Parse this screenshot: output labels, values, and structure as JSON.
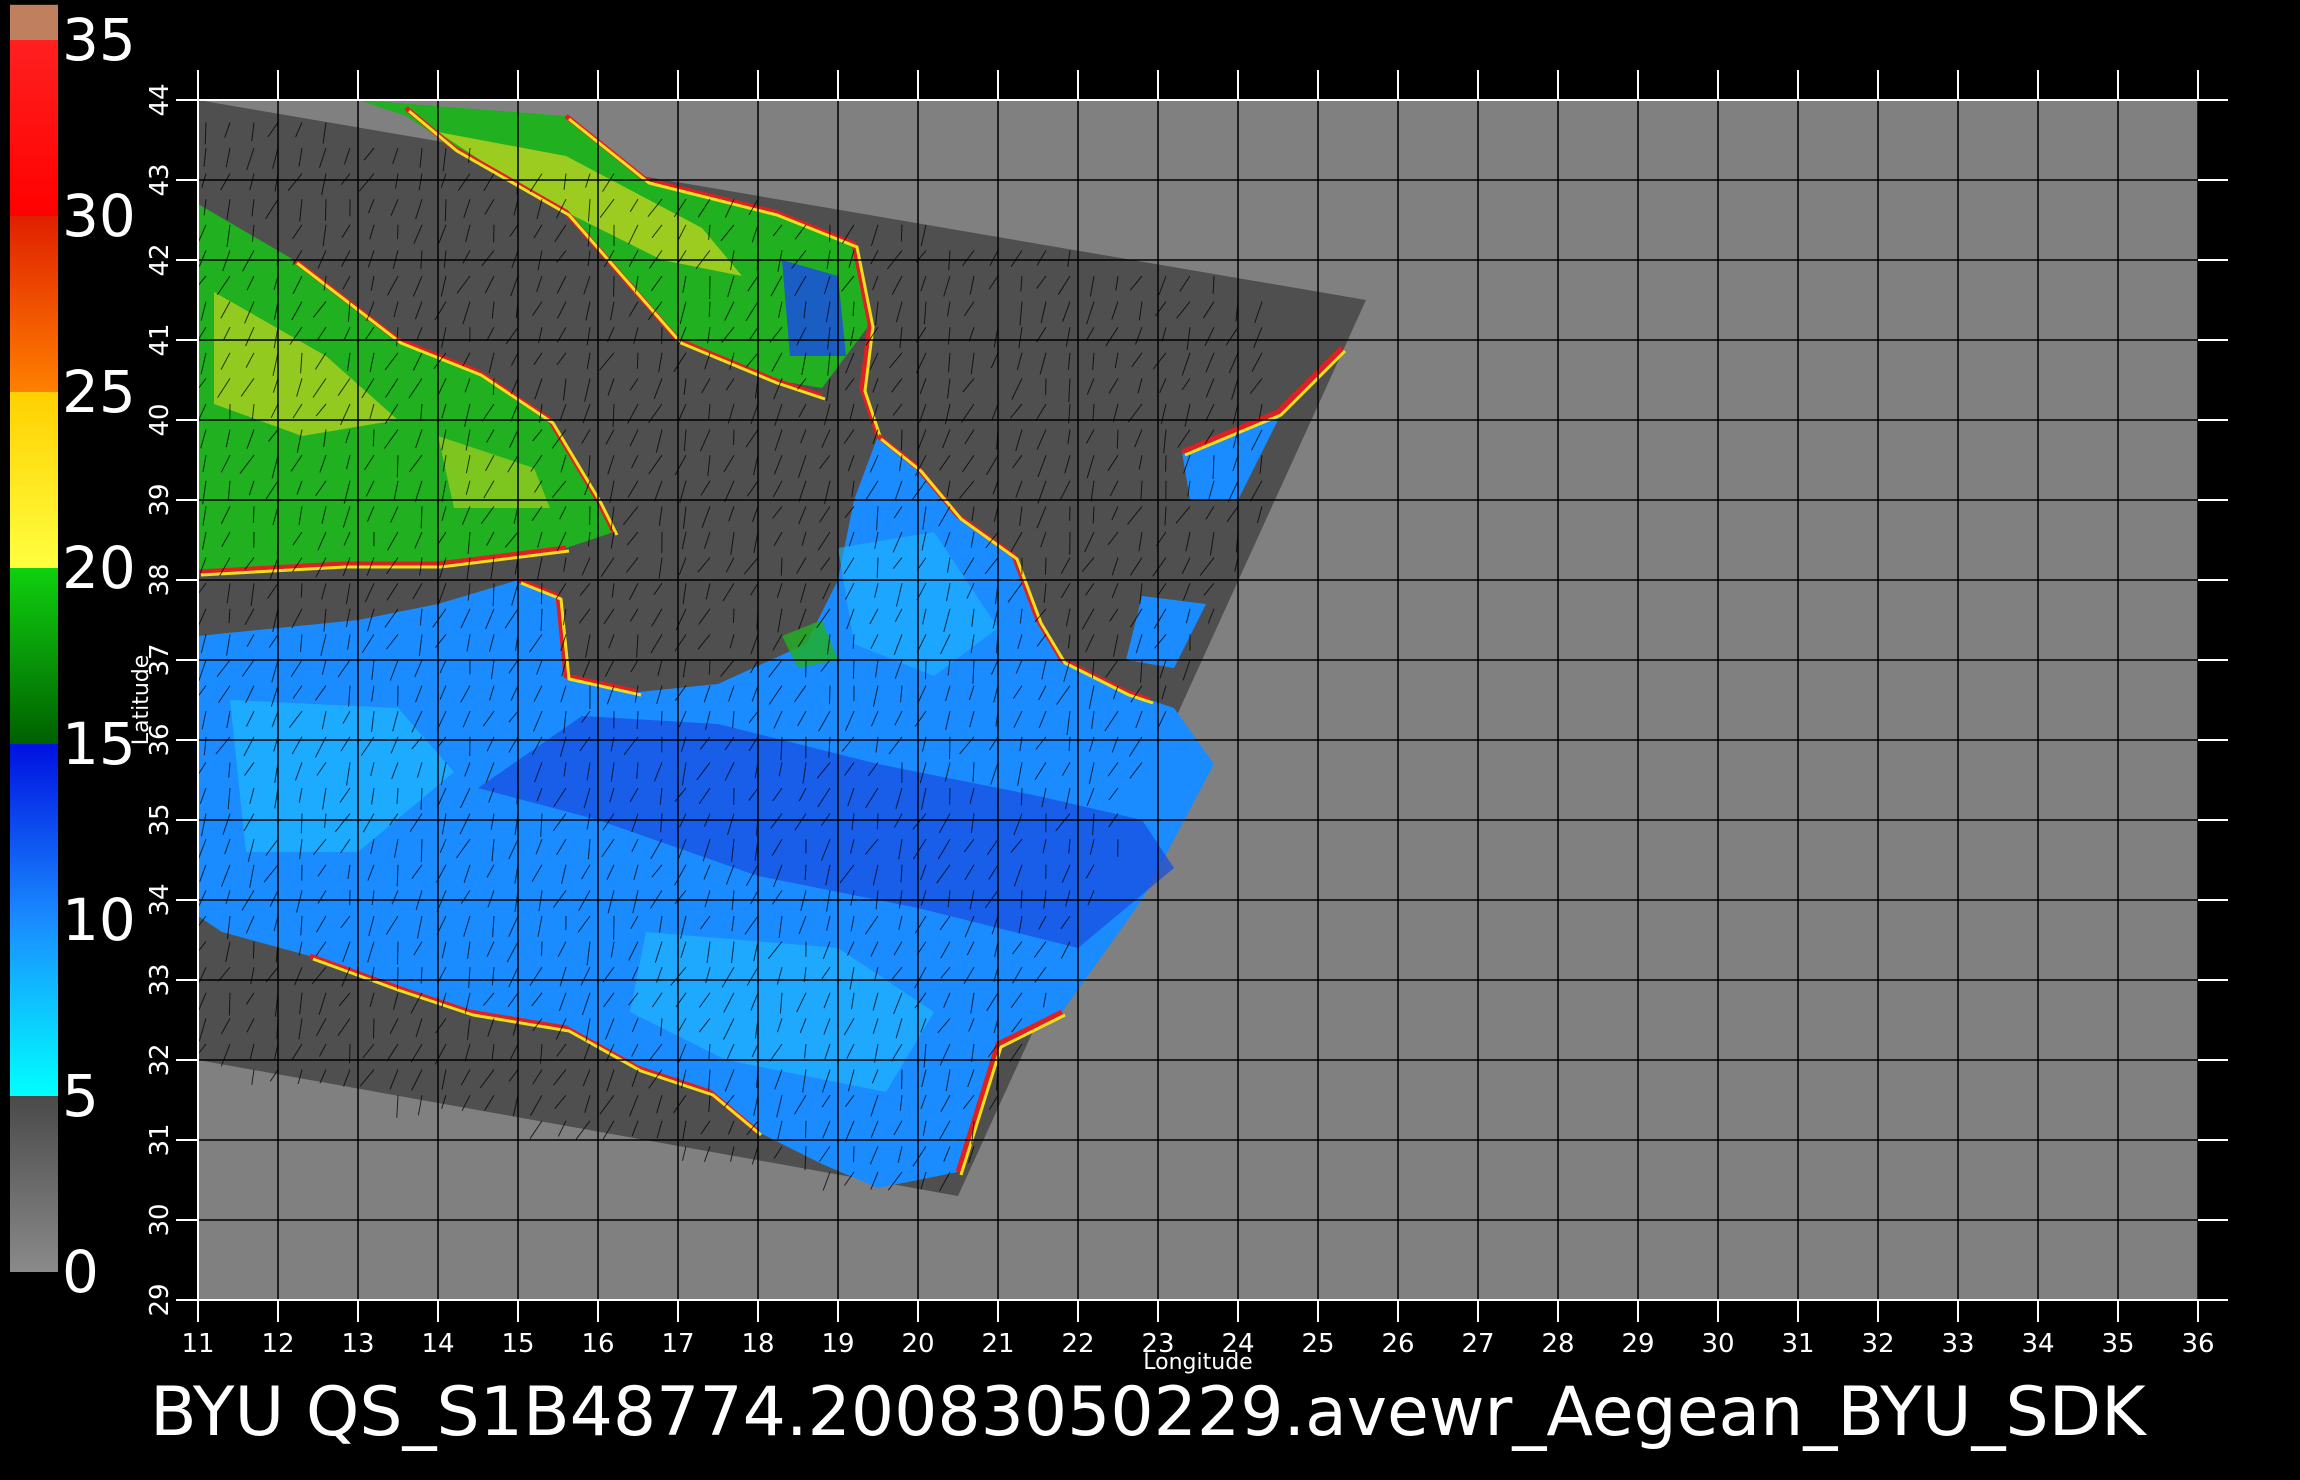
{
  "caption": "BYU  QS_S1B48774.20083050229.avewr_Aegean_BYU_SDK",
  "axes": {
    "xlabel": "Longitude",
    "ylabel": "Latitude",
    "xlim": [
      11,
      36
    ],
    "ylim": [
      29,
      44
    ],
    "x_ticks": [
      "11",
      "12",
      "13",
      "14",
      "15",
      "16",
      "17",
      "18",
      "19",
      "20",
      "21",
      "22",
      "23",
      "24",
      "25",
      "26",
      "27",
      "28",
      "29",
      "30",
      "31",
      "32",
      "33",
      "34",
      "35",
      "36"
    ],
    "y_ticks": [
      "29",
      "30",
      "31",
      "32",
      "33",
      "34",
      "35",
      "36",
      "37",
      "38",
      "39",
      "40",
      "41",
      "42",
      "43",
      "44"
    ],
    "grid": true
  },
  "colorbar": {
    "min": 0,
    "max": 35,
    "labels": [
      "35",
      "30",
      "25",
      "20",
      "15",
      "10",
      "5",
      "0"
    ],
    "stops": [
      {
        "from": 0,
        "to": 5,
        "top": "#4a4a4a",
        "bottom": "#8a8a8a"
      },
      {
        "from": 5,
        "to": 10,
        "top": "#1a8cff",
        "bottom": "#00ffff"
      },
      {
        "from": 10,
        "to": 15,
        "top": "#0010e0",
        "bottom": "#1a8cff"
      },
      {
        "from": 15,
        "to": 20,
        "top": "#10d010",
        "bottom": "#006000"
      },
      {
        "from": 20,
        "to": 25,
        "top": "#ffd000",
        "bottom": "#ffff40"
      },
      {
        "from": 25,
        "to": 30,
        "top": "#e02000",
        "bottom": "#ff8000"
      },
      {
        "from": 30,
        "to": 35,
        "top": "#ff2020",
        "bottom": "#ff0000"
      },
      {
        "from": 35,
        "to": 36,
        "top": "#c08060",
        "bottom": "#c08060"
      }
    ]
  },
  "colors": {
    "background": "#000000",
    "plot_bg": "#808080",
    "swath": "#4f4f4f",
    "grid": "#000000",
    "wind_deep": "#1a4fe0",
    "wind_mid": "#1a8cff",
    "wind_light": "#20b8ff",
    "wind_green": "#20b020",
    "wind_yellow": "#f0e020",
    "wind_red": "#e02020"
  },
  "map": {
    "title_region": "Aegean",
    "swath_corners_lonlat": [
      [
        11,
        44
      ],
      [
        25.6,
        41.5
      ],
      [
        20.5,
        30.3
      ],
      [
        11,
        32
      ]
    ]
  }
}
